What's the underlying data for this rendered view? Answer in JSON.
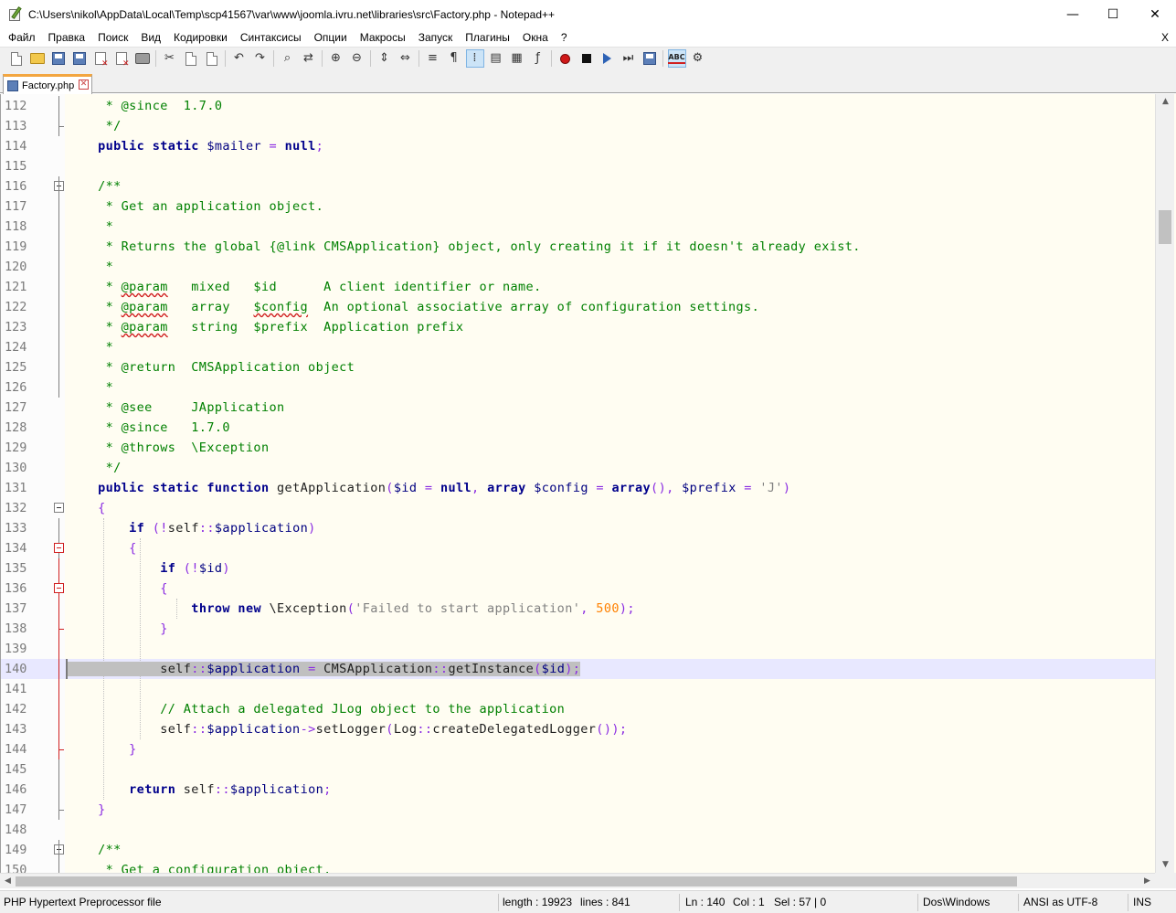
{
  "window": {
    "title": "C:\\Users\\nikol\\AppData\\Local\\Temp\\scp41567\\var\\www\\joomla.ivru.net\\libraries\\src\\Factory.php - Notepad++",
    "minimize": "—",
    "maximize": "☐",
    "close": "✕"
  },
  "menu": {
    "items": [
      "Файл",
      "Правка",
      "Поиск",
      "Вид",
      "Кодировки",
      "Синтаксисы",
      "Опции",
      "Макросы",
      "Запуск",
      "Плагины",
      "Окна",
      "?"
    ],
    "close": "X"
  },
  "toolbar": {
    "icons": [
      "new-file-icon",
      "open-file-icon",
      "save-icon",
      "save-all-icon",
      "close-icon",
      "close-all-icon",
      "print-icon",
      "cut-icon",
      "copy-icon",
      "paste-icon",
      "undo-icon",
      "redo-icon",
      "find-icon",
      "replace-icon",
      "zoom-in-icon",
      "zoom-out-icon",
      "sync-vertical-icon",
      "sync-horizontal-icon",
      "word-wrap-icon",
      "show-all-chars-icon",
      "indent-guide-icon",
      "user-lang-icon",
      "doc-map-icon",
      "function-list-icon",
      "folder-workspace-icon",
      "record-macro-icon",
      "stop-record-icon",
      "play-macro-icon",
      "run-macro-multiple-icon",
      "save-macro-icon",
      "spell-check-icon",
      "spell-check-settings-icon"
    ]
  },
  "tab": {
    "label": "Factory.php",
    "close": "✕"
  },
  "editor": {
    "current_line": 140,
    "lines": [
      {
        "n": "112",
        "tokens": [
          [
            "cm",
            "     * @since  1.7.0"
          ]
        ]
      },
      {
        "n": "113",
        "tokens": [
          [
            "cm",
            "     */"
          ]
        ]
      },
      {
        "n": "114",
        "tokens": [
          [
            "nm",
            "    "
          ],
          [
            "kw",
            "public"
          ],
          [
            "nm",
            " "
          ],
          [
            "kw",
            "static"
          ],
          [
            "nm",
            " "
          ],
          [
            "var",
            "$mailer"
          ],
          [
            "nm",
            " "
          ],
          [
            "op",
            "="
          ],
          [
            "nm",
            " "
          ],
          [
            "kw",
            "null"
          ],
          [
            "op",
            ";"
          ]
        ]
      },
      {
        "n": "115",
        "tokens": []
      },
      {
        "n": "116",
        "tokens": [
          [
            "cm",
            "    /**"
          ]
        ]
      },
      {
        "n": "117",
        "tokens": [
          [
            "cm",
            "     * Get an application object."
          ]
        ]
      },
      {
        "n": "118",
        "tokens": [
          [
            "cm",
            "     *"
          ]
        ]
      },
      {
        "n": "119",
        "tokens": [
          [
            "cm",
            "     * Returns the global {@link CMSApplication} object, only creating it if it doesn't already exist."
          ]
        ]
      },
      {
        "n": "120",
        "tokens": [
          [
            "cm",
            "     *"
          ]
        ]
      },
      {
        "n": "121",
        "tokens": [
          [
            "cm",
            "     * "
          ],
          [
            "tag",
            "@param"
          ],
          [
            "cm",
            "   mixed   $id      A client identifier or name."
          ]
        ]
      },
      {
        "n": "122",
        "tokens": [
          [
            "cm",
            "     * "
          ],
          [
            "tag",
            "@param"
          ],
          [
            "cm",
            "   array   "
          ],
          [
            "tag",
            "$config"
          ],
          [
            "cm",
            "  An optional associative array of configuration settings."
          ]
        ]
      },
      {
        "n": "123",
        "tokens": [
          [
            "cm",
            "     * "
          ],
          [
            "tag",
            "@param"
          ],
          [
            "cm",
            "   string  $prefix  Application prefix"
          ]
        ]
      },
      {
        "n": "124",
        "tokens": [
          [
            "cm",
            "     *"
          ]
        ]
      },
      {
        "n": "125",
        "tokens": [
          [
            "cm",
            "     * @return  CMSApplication object"
          ]
        ]
      },
      {
        "n": "126",
        "tokens": [
          [
            "cm",
            "     *"
          ]
        ]
      },
      {
        "n": "127",
        "tokens": [
          [
            "cm",
            "     * @see     JApplication"
          ]
        ]
      },
      {
        "n": "128",
        "tokens": [
          [
            "cm",
            "     * @since   1.7.0"
          ]
        ]
      },
      {
        "n": "129",
        "tokens": [
          [
            "cm",
            "     * @throws  \\Exception"
          ]
        ]
      },
      {
        "n": "130",
        "tokens": [
          [
            "cm",
            "     */"
          ]
        ]
      },
      {
        "n": "131",
        "tokens": [
          [
            "nm",
            "    "
          ],
          [
            "kw",
            "public"
          ],
          [
            "nm",
            " "
          ],
          [
            "kw",
            "static"
          ],
          [
            "nm",
            " "
          ],
          [
            "kw",
            "function"
          ],
          [
            "nm",
            " getApplication"
          ],
          [
            "pun",
            "("
          ],
          [
            "var",
            "$id"
          ],
          [
            "nm",
            " "
          ],
          [
            "op",
            "="
          ],
          [
            "nm",
            " "
          ],
          [
            "kw",
            "null"
          ],
          [
            "pun",
            ","
          ],
          [
            "nm",
            " "
          ],
          [
            "kw",
            "array"
          ],
          [
            "nm",
            " "
          ],
          [
            "var",
            "$config"
          ],
          [
            "nm",
            " "
          ],
          [
            "op",
            "="
          ],
          [
            "nm",
            " "
          ],
          [
            "kw",
            "array"
          ],
          [
            "pun",
            "(),"
          ],
          [
            "nm",
            " "
          ],
          [
            "var",
            "$prefix"
          ],
          [
            "nm",
            " "
          ],
          [
            "op",
            "="
          ],
          [
            "nm",
            " "
          ],
          [
            "str",
            "'J'"
          ],
          [
            "pun",
            ")"
          ]
        ]
      },
      {
        "n": "132",
        "tokens": [
          [
            "nm",
            "    "
          ],
          [
            "pun",
            "{"
          ]
        ]
      },
      {
        "n": "133",
        "tokens": [
          [
            "nm",
            "        "
          ],
          [
            "kw",
            "if"
          ],
          [
            "nm",
            " "
          ],
          [
            "pun",
            "(!"
          ],
          [
            "nm",
            "self"
          ],
          [
            "op",
            "::"
          ],
          [
            "var",
            "$application"
          ],
          [
            "pun",
            ")"
          ]
        ]
      },
      {
        "n": "134",
        "tokens": [
          [
            "nm",
            "        "
          ],
          [
            "pun",
            "{"
          ]
        ]
      },
      {
        "n": "135",
        "tokens": [
          [
            "nm",
            "            "
          ],
          [
            "kw",
            "if"
          ],
          [
            "nm",
            " "
          ],
          [
            "pun",
            "(!"
          ],
          [
            "var",
            "$id"
          ],
          [
            "pun",
            ")"
          ]
        ]
      },
      {
        "n": "136",
        "tokens": [
          [
            "nm",
            "            "
          ],
          [
            "pun",
            "{"
          ]
        ]
      },
      {
        "n": "137",
        "tokens": [
          [
            "nm",
            "                "
          ],
          [
            "kw",
            "throw"
          ],
          [
            "nm",
            " "
          ],
          [
            "kw",
            "new"
          ],
          [
            "nm",
            " \\Exception"
          ],
          [
            "pun",
            "("
          ],
          [
            "str",
            "'Failed to start application'"
          ],
          [
            "pun",
            ","
          ],
          [
            "nm",
            " "
          ],
          [
            "num",
            "500"
          ],
          [
            "pun",
            ");"
          ]
        ]
      },
      {
        "n": "138",
        "tokens": [
          [
            "nm",
            "            "
          ],
          [
            "pun",
            "}"
          ]
        ]
      },
      {
        "n": "139",
        "tokens": []
      },
      {
        "n": "140",
        "tokens": [
          [
            "nm",
            "            self"
          ],
          [
            "op",
            "::"
          ],
          [
            "var",
            "$application"
          ],
          [
            "nm",
            " "
          ],
          [
            "op",
            "="
          ],
          [
            "nm",
            " CMSApplication"
          ],
          [
            "op",
            "::"
          ],
          [
            "nm",
            "getInstance"
          ],
          [
            "pun",
            "("
          ],
          [
            "var",
            "$id"
          ],
          [
            "pun",
            ");"
          ]
        ]
      },
      {
        "n": "141",
        "tokens": []
      },
      {
        "n": "142",
        "tokens": [
          [
            "nm",
            "            "
          ],
          [
            "cm",
            "// Attach a delegated JLog object to the application"
          ]
        ]
      },
      {
        "n": "143",
        "tokens": [
          [
            "nm",
            "            self"
          ],
          [
            "op",
            "::"
          ],
          [
            "var",
            "$application"
          ],
          [
            "op",
            "->"
          ],
          [
            "nm",
            "setLogger"
          ],
          [
            "pun",
            "("
          ],
          [
            "nm",
            "Log"
          ],
          [
            "op",
            "::"
          ],
          [
            "nm",
            "createDelegatedLogger"
          ],
          [
            "pun",
            "());"
          ]
        ]
      },
      {
        "n": "144",
        "tokens": [
          [
            "nm",
            "        "
          ],
          [
            "pun",
            "}"
          ]
        ]
      },
      {
        "n": "145",
        "tokens": []
      },
      {
        "n": "146",
        "tokens": [
          [
            "nm",
            "        "
          ],
          [
            "kw",
            "return"
          ],
          [
            "nm",
            " self"
          ],
          [
            "op",
            "::"
          ],
          [
            "var",
            "$application"
          ],
          [
            "pun",
            ";"
          ]
        ]
      },
      {
        "n": "147",
        "tokens": [
          [
            "nm",
            "    "
          ],
          [
            "pun",
            "}"
          ]
        ]
      },
      {
        "n": "148",
        "tokens": []
      },
      {
        "n": "149",
        "tokens": [
          [
            "cm",
            "    /**"
          ]
        ]
      },
      {
        "n": "150",
        "tokens": [
          [
            "cm",
            "     * Get a configuration object."
          ]
        ]
      }
    ]
  },
  "status": {
    "file_type": "PHP Hypertext Preprocessor file",
    "length": "length : 19923",
    "lines": "lines : 841",
    "ln": "Ln : 140",
    "col": "Col : 1",
    "sel": "Sel : 57 | 0",
    "eol": "Dos\\Windows",
    "encoding": "ANSI as UTF-8",
    "mode": "INS"
  },
  "colors": {
    "editor_bg": "#fffdf2",
    "current_line": "#e8e8ff",
    "tab_accent": "#f3a640",
    "comment": "#008000",
    "keyword": "#00008b",
    "variable": "#000080",
    "operator": "#8a2be2",
    "string": "#808080",
    "number": "#ff8000"
  }
}
